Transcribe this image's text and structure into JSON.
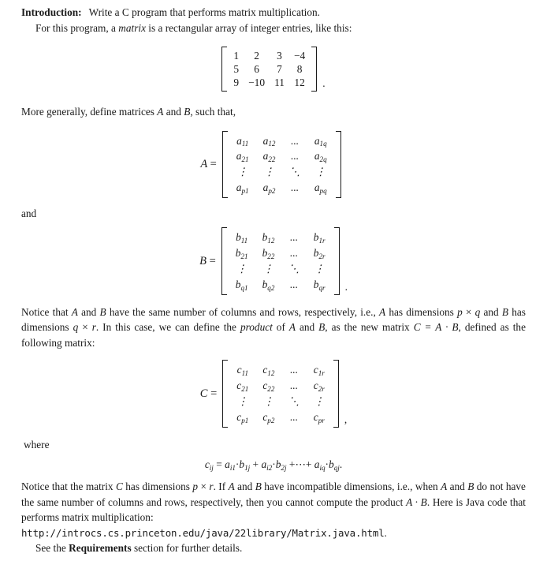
{
  "document": {
    "intro": {
      "heading": "Introduction:",
      "line1": "Write a C program that performs matrix multiplication.",
      "line2_pre": "For this program, a ",
      "line2_ital": "matrix",
      "line2_post": " is a rectangular array of integer entries, like this:"
    },
    "example_matrix": {
      "rows": [
        [
          "1",
          "2",
          "3",
          "−4"
        ],
        [
          "5",
          "6",
          "7",
          "8"
        ],
        [
          "9",
          "−10",
          "11",
          "12"
        ]
      ],
      "trailing_punct": "."
    },
    "more_generally": {
      "pre": "More generally, define matrices ",
      "var_a": "A",
      "mid": " and ",
      "var_b": "B",
      "post": ", such that,"
    },
    "matrix_a": {
      "label": "A",
      "equals": "=",
      "rows": [
        [
          "a",
          "11",
          "a",
          "12",
          "...",
          "a",
          "1q"
        ],
        [
          "a",
          "21",
          "a",
          "22",
          "...",
          "a",
          "2q"
        ],
        [
          "vdots",
          "vdots",
          "ddots",
          "vdots"
        ],
        [
          "a",
          "p1",
          "a",
          "p2",
          "...",
          "a",
          "pq"
        ]
      ],
      "trailing_punct": ""
    },
    "and_label": "and",
    "matrix_b": {
      "label": "B",
      "equals": "=",
      "rows": [
        [
          "b",
          "11",
          "b",
          "12",
          "...",
          "b",
          "1r"
        ],
        [
          "b",
          "21",
          "b",
          "22",
          "...",
          "b",
          "2r"
        ],
        [
          "vdots",
          "vdots",
          "ddots",
          "vdots"
        ],
        [
          "b",
          "q1",
          "b",
          "q2",
          "...",
          "b",
          "qr"
        ]
      ],
      "trailing_punct": "."
    },
    "notice_para": {
      "t1": "Notice that ",
      "a1": "A",
      "t2": " and ",
      "b1": "B",
      "t3": " have the same number of columns and rows, respectively, i.e., ",
      "a2": "A",
      "t4": " has dimensions ",
      "p1": "p",
      "x1": " × ",
      "q1": "q",
      "t5": " and ",
      "b2": "B",
      "t6": " has dimensions ",
      "q2": "q",
      "x2": " × ",
      "r1": "r",
      "t7": ". In this case, we can define the ",
      "product_ital": "product",
      "t8": " of ",
      "a3": "A",
      "t9": " and ",
      "b3": "B",
      "t10": ", as the new matrix ",
      "c_eq": "C = A · B",
      "t11": ", defined as the following matrix:"
    },
    "matrix_c": {
      "label": "C",
      "equals": "=",
      "rows": [
        [
          "c",
          "11",
          "c",
          "12",
          "...",
          "c",
          "1r"
        ],
        [
          "c",
          "21",
          "c",
          "22",
          "...",
          "c",
          "2r"
        ],
        [
          "vdots",
          "vdots",
          "ddots",
          "vdots"
        ],
        [
          "c",
          "p1",
          "c",
          "p2",
          "...",
          "c",
          "pr"
        ]
      ],
      "trailing_punct": ","
    },
    "where_label": "where",
    "formula": {
      "lhs_base": "c",
      "lhs_sub": "ij",
      "equals": "=",
      "term1_base": "a",
      "term1_sub": "i1",
      "dot1": "·",
      "term2_base": "b",
      "term2_sub": "1j",
      "plus1": "+",
      "term3_base": "a",
      "term3_sub": "i2",
      "dot2": "·",
      "term4_base": "b",
      "term4_sub": "2j",
      "plus2": "+",
      "cdots": "⋯",
      "plus3": "+",
      "term5_base": "a",
      "term5_sub": "iq",
      "dot3": "·",
      "term6_base": "b",
      "term6_sub": "qj",
      "period": "."
    },
    "closing_para": {
      "t1": "Notice that the matrix ",
      "c1": "C",
      "t2": " has dimensions ",
      "p1": "p",
      "x1": " × ",
      "r1": "r",
      "t3": ". If ",
      "a1": "A",
      "t4": " and ",
      "b1": "B",
      "t5": " have incompatible dimensions, i.e., when ",
      "a2": "A",
      "t6": " and ",
      "b2": "B",
      "t7": " do not have the same number of columns and rows, respectively, then you cannot compute the product ",
      "ab": "A · B",
      "t8": ". Here is Java code that performs matrix multiplication:",
      "url": "http://introcs.cs.princeton.edu/java/22library/Matrix.java.html",
      "url_period": "."
    },
    "final_line": {
      "pre": "See the ",
      "bold": "Requirements",
      "post": " section for further details."
    }
  }
}
